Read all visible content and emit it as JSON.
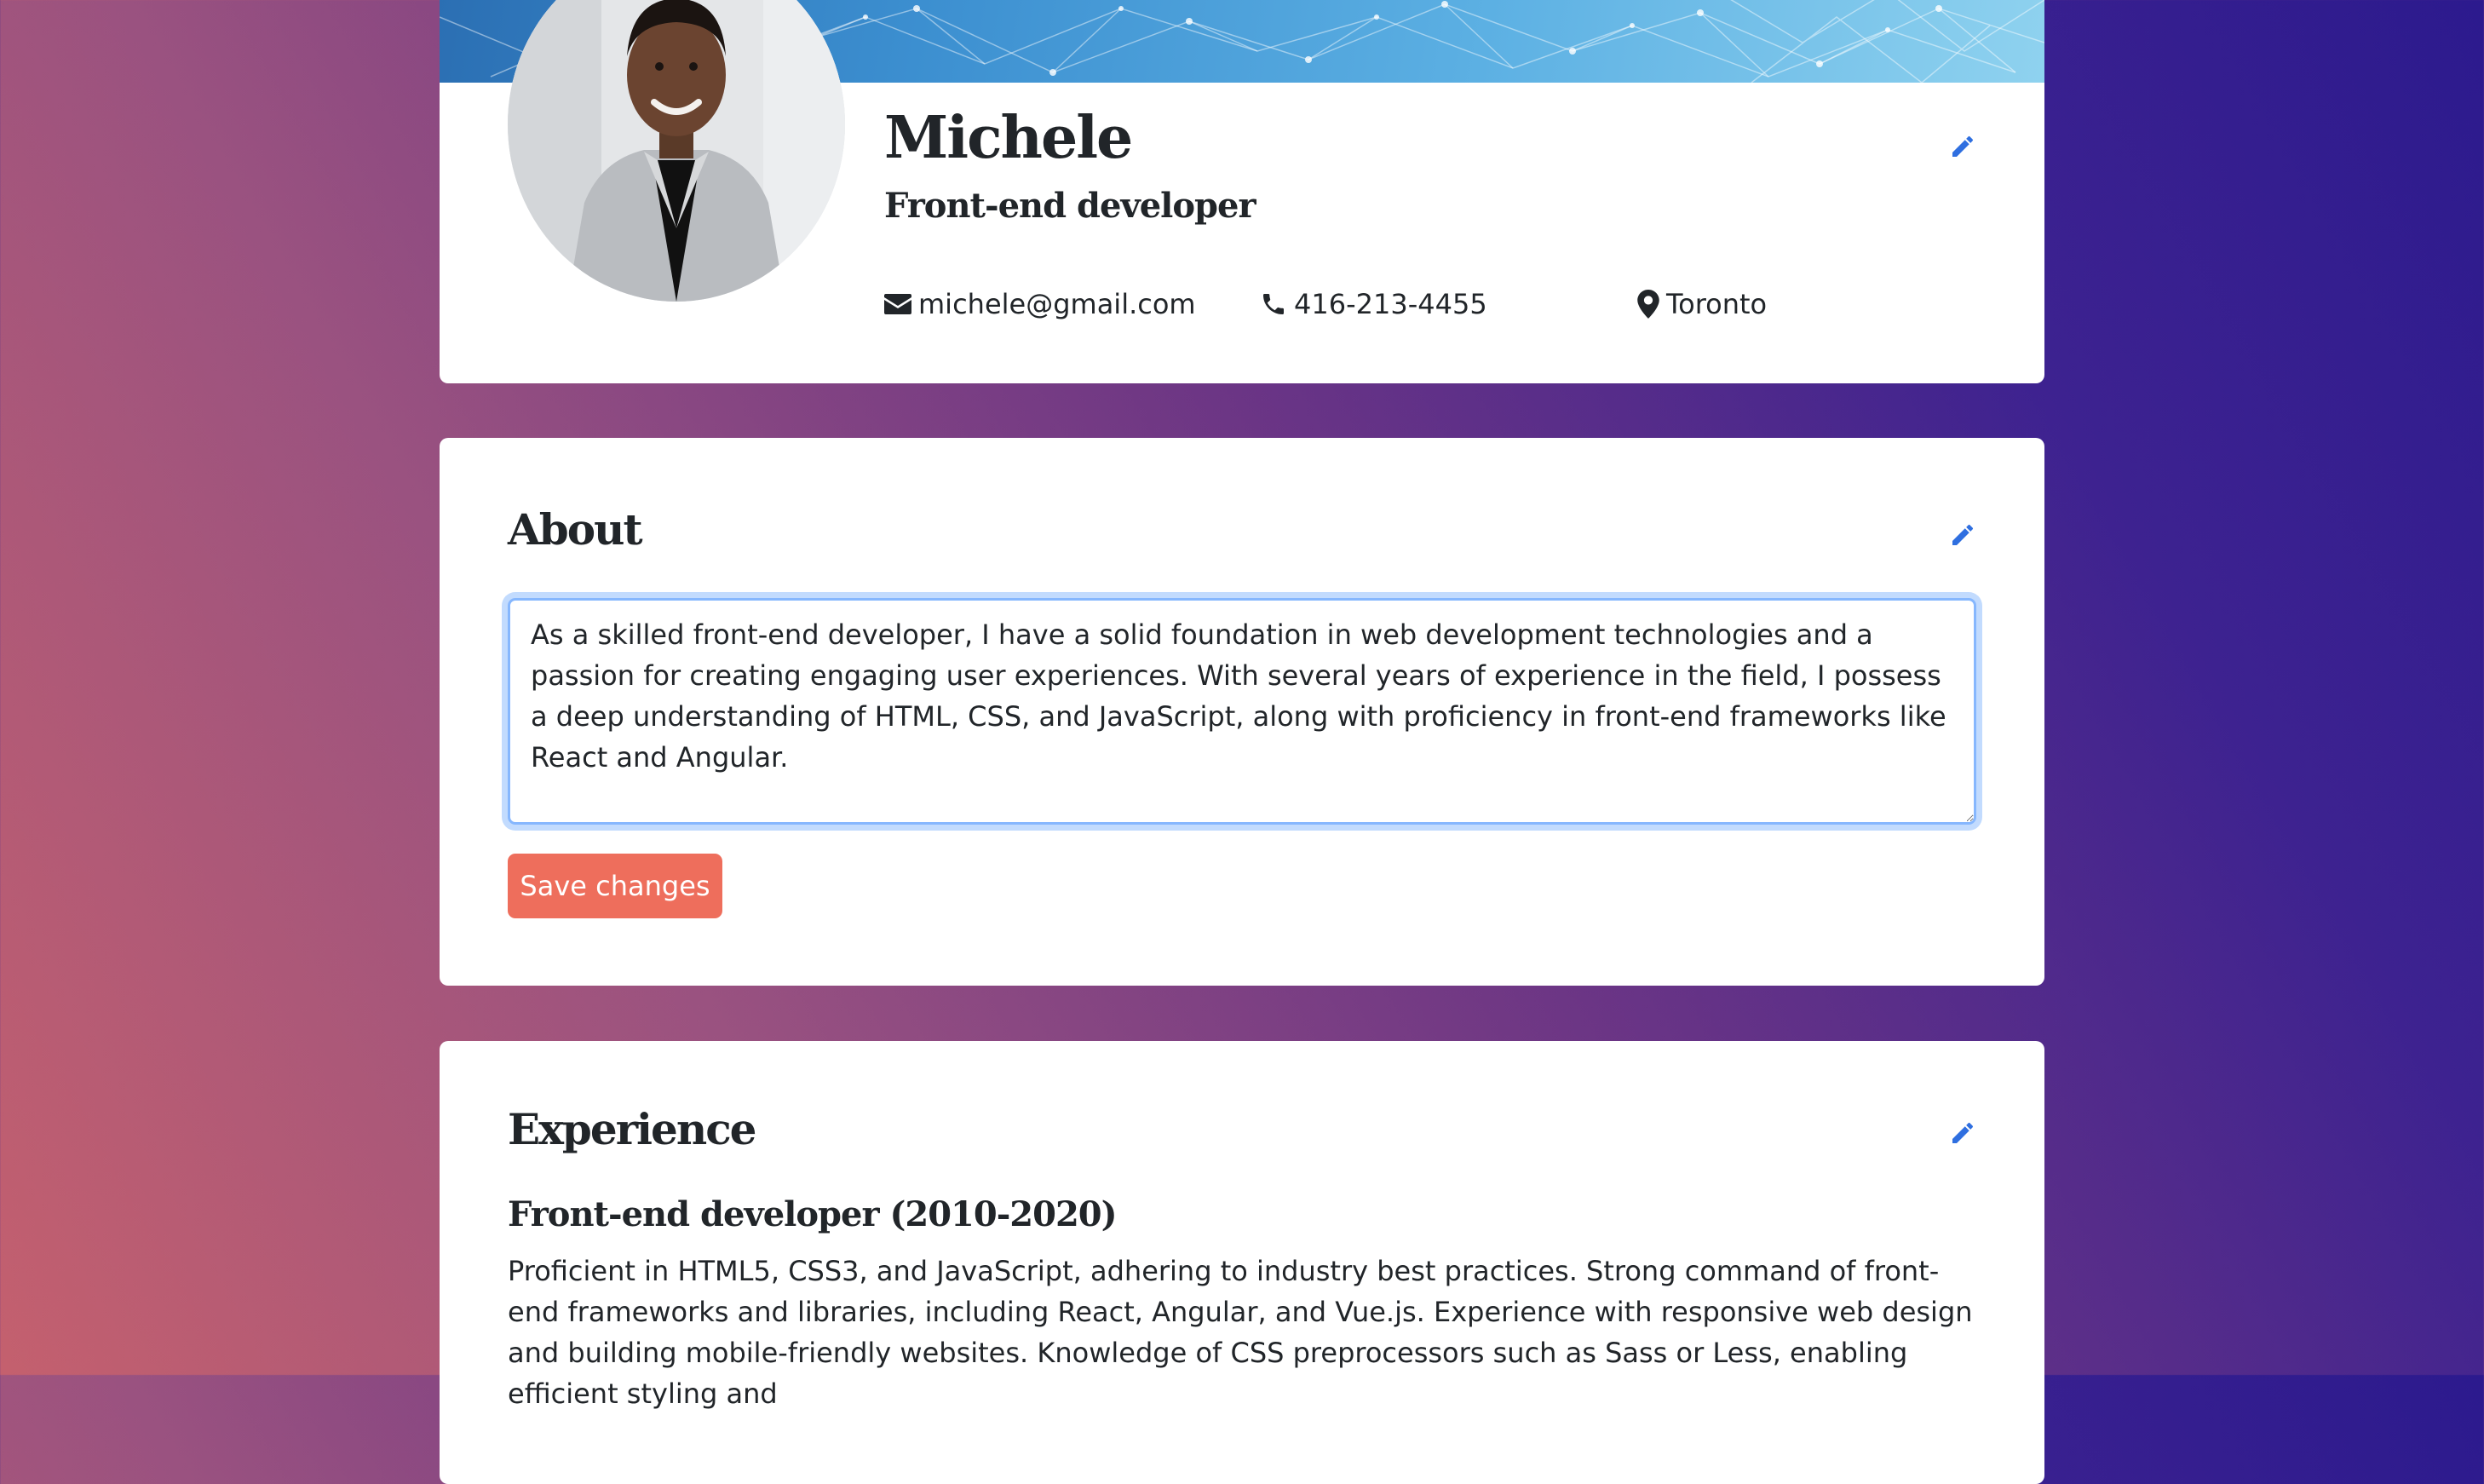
{
  "profile": {
    "name": "Michele",
    "job_title": "Front-end developer",
    "email": "michele@gmail.com",
    "phone": "416-213-4455",
    "location": "Toronto",
    "edit_icon": "pencil-icon",
    "contact_icons": [
      "envelope-icon",
      "phone-icon",
      "map-pin-icon"
    ]
  },
  "about": {
    "title": "About",
    "text": "As a skilled front-end developer, I have a solid foundation in web development technologies and a passion for creating engaging user experiences. With several years of experience in the field, I possess a deep understanding of HTML, CSS, and JavaScript, along with proficiency in front-end frameworks like React and Angular.",
    "save_label": "Save changes"
  },
  "experience": {
    "title": "Experience",
    "items": [
      {
        "title": "Front-end developer (2010-2020)",
        "description": "Proficient in HTML5, CSS3, and JavaScript, adhering to industry best practices. Strong command of front-end frameworks and libraries, including React, Angular, and Vue.js. Experience with responsive web design and building mobile-friendly websites. Knowledge of CSS preprocessors such as Sass or Less, enabling efficient styling and"
      }
    ]
  },
  "colors": {
    "accent": "#2f6fe0",
    "save_button": "#ee6e5c",
    "card": "#ffffff",
    "text": "#212529"
  }
}
